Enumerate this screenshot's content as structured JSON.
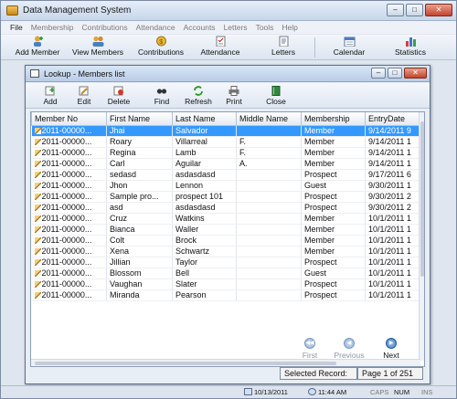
{
  "app": {
    "title": "Data Management System",
    "win_min": "–",
    "win_max": "□",
    "win_close": "✕"
  },
  "menu": [
    "File",
    "Membership",
    "Contributions",
    "Attendance",
    "Accounts",
    "Letters",
    "Tools",
    "Help"
  ],
  "toolbar": {
    "add_member": "Add Member",
    "view_members": "View Members",
    "contributions": "Contributions",
    "attendance": "Attendance",
    "letters": "Letters",
    "calendar": "Calendar",
    "statistics": "Statistics"
  },
  "lookup": {
    "title": "Lookup - Members list",
    "buttons": {
      "add": "Add",
      "edit": "Edit",
      "delete": "Delete",
      "find": "Find",
      "refresh": "Refresh",
      "print": "Print",
      "close": "Close"
    },
    "columns": [
      "Member No",
      "First Name",
      "Last Name",
      "Middle Name",
      "Membership",
      "EntryDate"
    ],
    "rows": [
      [
        "2011-00000...",
        "Jhai",
        "Salvador",
        "",
        "Member",
        "9/14/2011 9"
      ],
      [
        "2011-00000...",
        "Roary",
        "Villarreal",
        "F.",
        "Member",
        "9/14/2011 1"
      ],
      [
        "2011-00000...",
        "Regina",
        "Lamb",
        "F.",
        "Member",
        "9/14/2011 1"
      ],
      [
        "2011-00000...",
        "Carl",
        "Aguilar",
        "A.",
        "Member",
        "9/14/2011 1"
      ],
      [
        "2011-00000...",
        "sedasd",
        "asdasdasd",
        "",
        "Prospect",
        "9/17/2011 6"
      ],
      [
        "2011-00000...",
        "Jhon",
        "Lennon",
        "",
        "Guest",
        "9/30/2011 1"
      ],
      [
        "2011-00000...",
        "Sample pro...",
        "prospect 101",
        "",
        "Prospect",
        "9/30/2011 2"
      ],
      [
        "2011-00000...",
        "asd",
        "asdasdasd",
        "",
        "Prospect",
        "9/30/2011 2"
      ],
      [
        "2011-00000...",
        "Cruz",
        "Watkins",
        "",
        "Member",
        "10/1/2011 1"
      ],
      [
        "2011-00000...",
        "Bianca",
        "Waller",
        "",
        "Member",
        "10/1/2011 1"
      ],
      [
        "2011-00000...",
        "Colt",
        "Brock",
        "",
        "Member",
        "10/1/2011 1"
      ],
      [
        "2011-00000...",
        "Xena",
        "Schwartz",
        "",
        "Member",
        "10/1/2011 1"
      ],
      [
        "2011-00000...",
        "Jillian",
        "Taylor",
        "",
        "Prospect",
        "10/1/2011 1"
      ],
      [
        "2011-00000...",
        "Blossom",
        "Bell",
        "",
        "Guest",
        "10/1/2011 1"
      ],
      [
        "2011-00000...",
        "Vaughan",
        "Slater",
        "",
        "Prospect",
        "10/1/2011 1"
      ],
      [
        "2011-00000...",
        "Miranda",
        "Pearson",
        "",
        "Prospect",
        "10/1/2011 1"
      ]
    ],
    "nav": {
      "first": "First",
      "previous": "Previous",
      "next": "Next"
    },
    "status": {
      "label": "Selected Record:",
      "page": "Page 1 of 251"
    }
  },
  "statusbar": {
    "date": "10/13/2011",
    "time": "11:44 AM",
    "caps": "CAPS",
    "num": "NUM",
    "ins": "INS"
  }
}
